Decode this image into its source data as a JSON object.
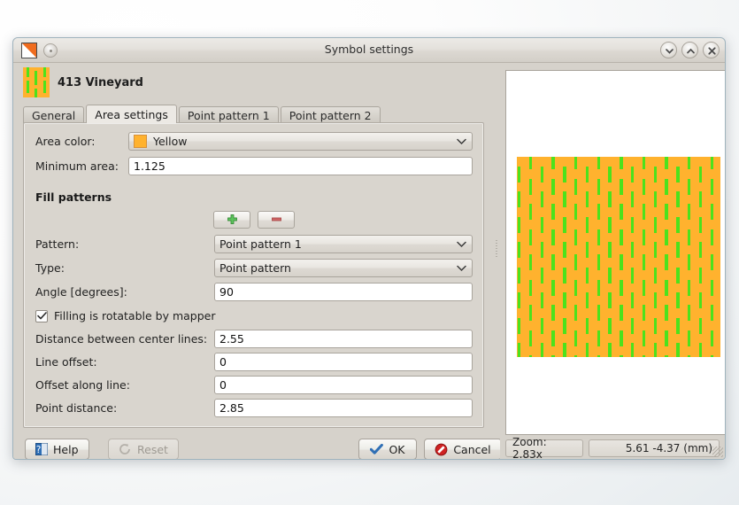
{
  "window": {
    "title": "Symbol settings",
    "app_icon": "orange-triangle-icon",
    "buttons": {
      "minimize": "chevron-down-icon",
      "shade": "chevron-up-icon",
      "close": "close-icon"
    }
  },
  "symbol": {
    "name": "413 Vineyard",
    "icon": "vineyard-symbol-icon",
    "fill_color": "#ffb22e",
    "line_color": "#4ce21c"
  },
  "tabs": [
    {
      "label": "General",
      "active": false
    },
    {
      "label": "Area settings",
      "active": true
    },
    {
      "label": "Point pattern 1",
      "active": false
    },
    {
      "label": "Point pattern 2",
      "active": false
    }
  ],
  "form": {
    "area_color": {
      "label": "Area color:",
      "value": "Yellow",
      "swatch": "#ffb22e"
    },
    "minimum_area": {
      "label": "Minimum area:",
      "value": "1.125"
    },
    "fill_patterns_title": "Fill patterns",
    "add_button": "plus-icon",
    "remove_button": "minus-icon",
    "pattern": {
      "label": "Pattern:",
      "value": "Point pattern 1"
    },
    "type": {
      "label": "Type:",
      "value": "Point pattern"
    },
    "angle": {
      "label": "Angle [degrees]:",
      "value": "90"
    },
    "rotatable": {
      "label": "Filling is rotatable by mapper",
      "checked": true
    },
    "distance_center_lines": {
      "label": "Distance between center lines:",
      "value": "2.55"
    },
    "line_offset": {
      "label": "Line offset:",
      "value": "0"
    },
    "offset_along_line": {
      "label": "Offset along line:",
      "value": "0"
    },
    "point_distance": {
      "label": "Point distance:",
      "value": "2.85"
    }
  },
  "footer": {
    "help": "Help",
    "reset": "Reset",
    "ok": "OK",
    "cancel": "Cancel"
  },
  "status": {
    "zoom": "Zoom: 2.83x",
    "coords": "5.61 -4.37 (mm)"
  },
  "preview": {
    "background": "#ffffff",
    "patch_fill": "#ffb22e",
    "dash_color": "#4ce21c"
  }
}
